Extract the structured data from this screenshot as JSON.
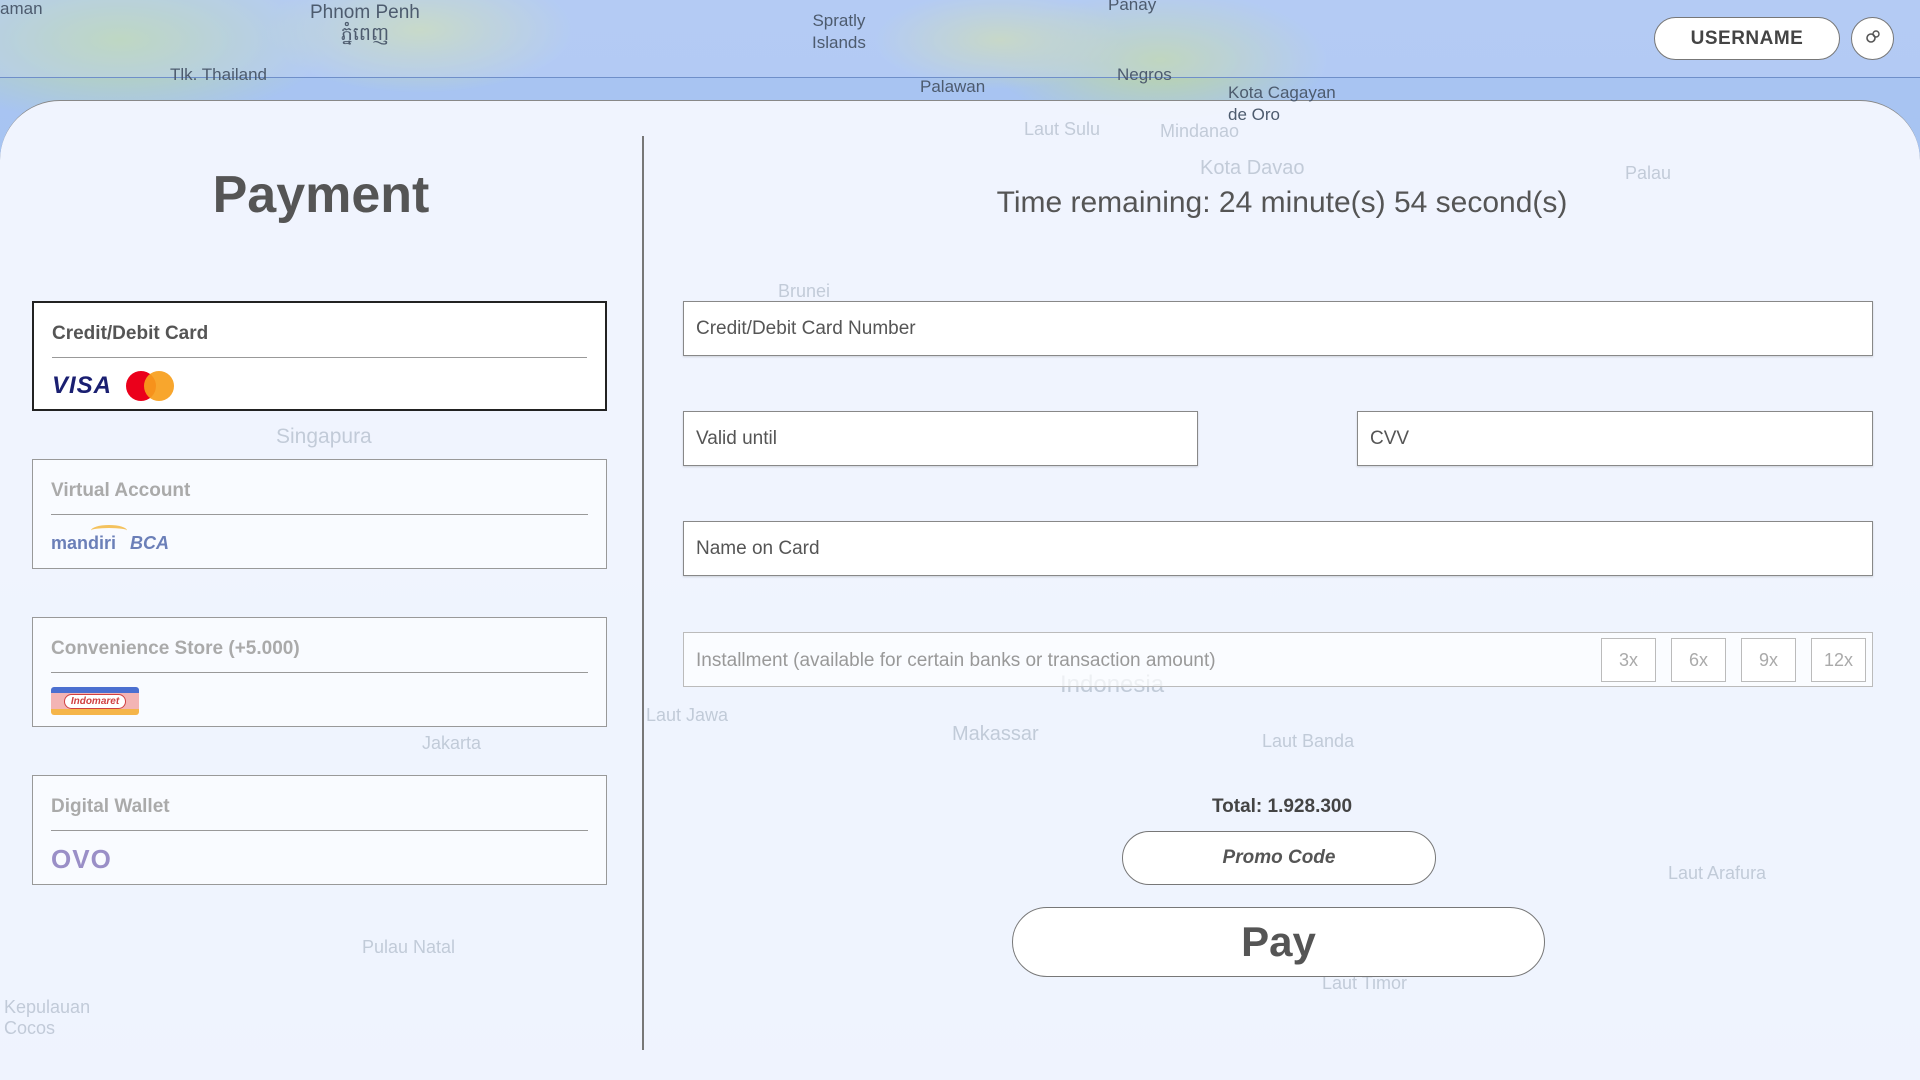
{
  "map": {
    "labels": [
      "aman",
      "Phnom Penh\nភ្នំពេញ",
      "Spratly\nIslands",
      "Panay",
      "Tlk. Thailand",
      "Palawan",
      "Negros",
      "Kota Cagayan\nde Oro"
    ],
    "faded_labels": [
      "Laut Sulu",
      "Mindanao",
      "Kota Davao",
      "Palau",
      "Brunei",
      "Singapura",
      "Indonesia",
      "Makassar",
      "Laut Jawa",
      "Laut Banda",
      "Jakarta",
      "Pulau Natal",
      "Laut Arafura",
      "Kepulauan\nCocos",
      "Laut Timor"
    ]
  },
  "header": {
    "username_label": "USERNAME",
    "settings_icon": "gear-icon"
  },
  "sidebar": {
    "title": "Payment",
    "methods": [
      {
        "label": "Credit/Debit Card",
        "logos": [
          "VISA",
          "mastercard"
        ],
        "selected": true
      },
      {
        "label": "Virtual Account",
        "logos": [
          "mandiri",
          "BCA"
        ],
        "selected": false
      },
      {
        "label": "Convenience Store (+5.000)",
        "logos": [
          "Indomaret"
        ],
        "selected": false
      },
      {
        "label": "Digital Wallet",
        "logos": [
          "OVO"
        ],
        "selected": false
      }
    ]
  },
  "form": {
    "timer": "Time remaining: 24 minute(s) 54 second(s)",
    "card_number_placeholder": "Credit/Debit Card Number",
    "valid_until_placeholder": "Valid until",
    "cvv_placeholder": "CVV",
    "name_placeholder": "Name on Card",
    "installment_label": "Installment (available for certain banks or transaction amount)",
    "installment_options": [
      "3x",
      "6x",
      "9x",
      "12x"
    ],
    "total": "Total: 1.928.300",
    "promo_label": "Promo Code",
    "pay_label": "Pay"
  },
  "colors": {
    "accent_border": "#222222",
    "visa": "#1a1f71",
    "mastercard_red": "#eb001b",
    "mastercard_orange": "#f79e1b"
  }
}
